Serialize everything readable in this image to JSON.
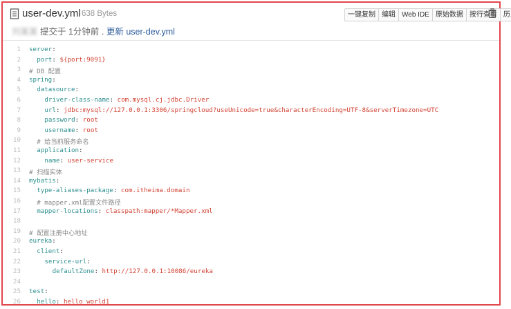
{
  "file": {
    "name": "user-dev.yml",
    "size": "638 Bytes"
  },
  "commit": {
    "author": "刘某某",
    "text": "提交于 1分钟前 . ",
    "link": "更新 user-dev.yml"
  },
  "toolbar": {
    "buttons": [
      "一键复制",
      "编辑",
      "Web IDE",
      "原始数据",
      "按行查看",
      "历史"
    ]
  },
  "icons": {
    "file": "file-text-icon",
    "delete": "trash-icon"
  },
  "colors": {
    "frame_border": "#e0464b",
    "key": "#2f8f8f",
    "value": "#d14334",
    "comment": "#888888",
    "link": "#2b5a9b"
  },
  "code": {
    "lines": [
      {
        "n": "1",
        "indent": 0,
        "k": "server",
        "v": "",
        "c": ""
      },
      {
        "n": "2",
        "indent": 1,
        "k": "port",
        "v": "${port:9091}",
        "c": ""
      },
      {
        "n": "3",
        "indent": 0,
        "k": "",
        "v": "",
        "c": "# DB 配置"
      },
      {
        "n": "4",
        "indent": 0,
        "k": "spring",
        "v": "",
        "c": ""
      },
      {
        "n": "5",
        "indent": 1,
        "k": "datasource",
        "v": "",
        "c": ""
      },
      {
        "n": "6",
        "indent": 2,
        "k": "driver-class-name",
        "v": "com.mysql.cj.jdbc.Driver",
        "c": ""
      },
      {
        "n": "7",
        "indent": 2,
        "k": "url",
        "v": "jdbc:mysql://127.0.0.1:3306/springcloud?useUnicode=true&characterEncoding=UTF-8&serverTimezone=UTC",
        "c": ""
      },
      {
        "n": "8",
        "indent": 2,
        "k": "password",
        "v": "root",
        "c": ""
      },
      {
        "n": "9",
        "indent": 2,
        "k": "username",
        "v": "root",
        "c": ""
      },
      {
        "n": "10",
        "indent": 1,
        "k": "",
        "v": "",
        "c": "# 给当前服务命名"
      },
      {
        "n": "11",
        "indent": 1,
        "k": "application",
        "v": "",
        "c": ""
      },
      {
        "n": "12",
        "indent": 2,
        "k": "name",
        "v": "user-service",
        "c": ""
      },
      {
        "n": "13",
        "indent": 0,
        "k": "",
        "v": "",
        "c": "# 扫描实体"
      },
      {
        "n": "14",
        "indent": 0,
        "k": "mybatis",
        "v": "",
        "c": ""
      },
      {
        "n": "15",
        "indent": 1,
        "k": "type-aliases-package",
        "v": "com.itheima.domain",
        "c": ""
      },
      {
        "n": "16",
        "indent": 1,
        "k": "",
        "v": "",
        "c": "# mapper.xml配置文件路径"
      },
      {
        "n": "17",
        "indent": 1,
        "k": "mapper-locations",
        "v": "classpath:mapper/*Mapper.xml",
        "c": ""
      },
      {
        "n": "18",
        "indent": 0,
        "k": "",
        "v": "",
        "c": ""
      },
      {
        "n": "19",
        "indent": 0,
        "k": "",
        "v": "",
        "c": "# 配置注册中心地址"
      },
      {
        "n": "20",
        "indent": 0,
        "k": "eureka",
        "v": "",
        "c": ""
      },
      {
        "n": "21",
        "indent": 1,
        "k": "client",
        "v": "",
        "c": ""
      },
      {
        "n": "22",
        "indent": 2,
        "k": "service-url",
        "v": "",
        "c": ""
      },
      {
        "n": "23",
        "indent": 3,
        "k": "defaultZone",
        "v": "http://127.0.0.1:10086/eureka",
        "c": ""
      },
      {
        "n": "24",
        "indent": 0,
        "k": "",
        "v": "",
        "c": ""
      },
      {
        "n": "25",
        "indent": 0,
        "k": "test",
        "v": "",
        "c": ""
      },
      {
        "n": "26",
        "indent": 1,
        "k": "hello",
        "v": "hello world1",
        "c": ""
      }
    ]
  }
}
